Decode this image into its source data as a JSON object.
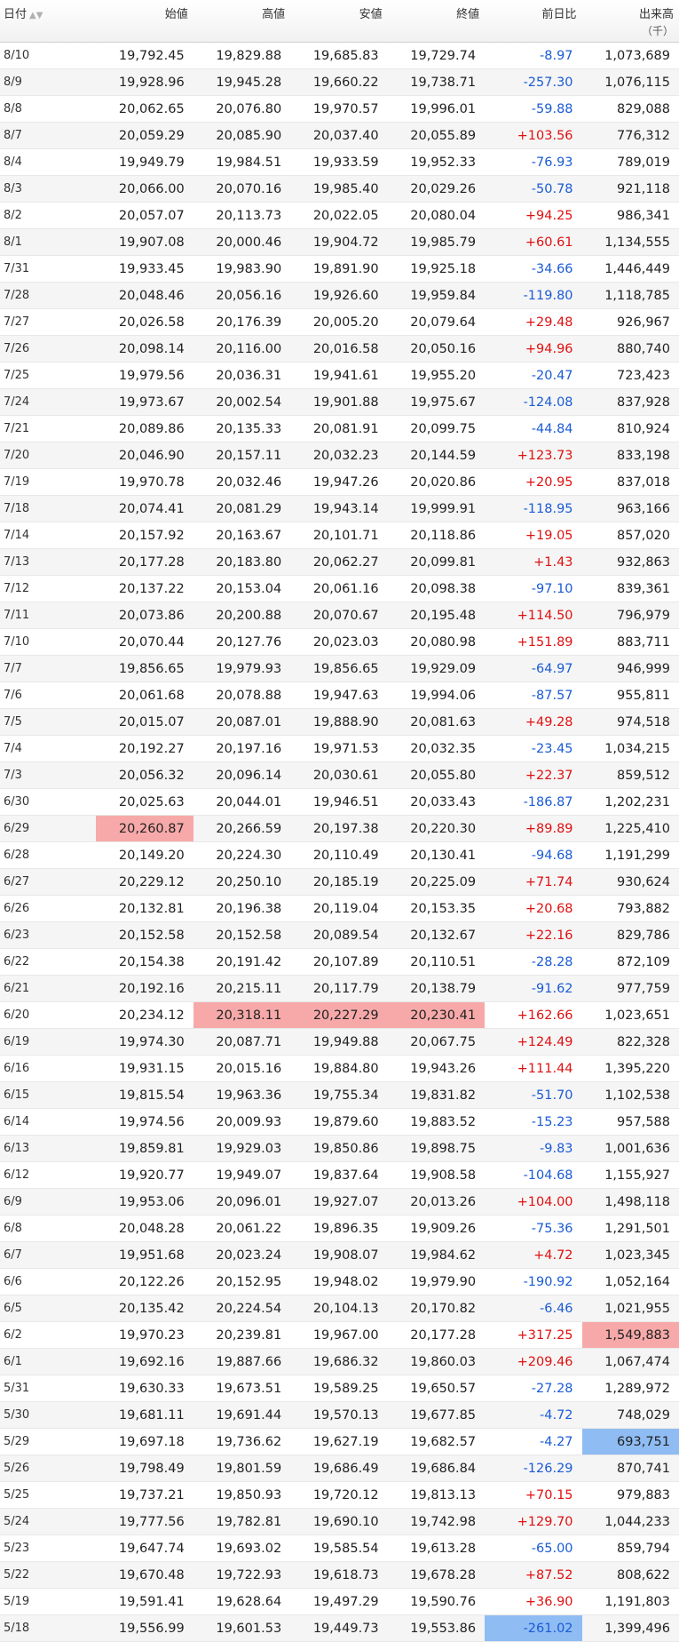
{
  "colors": {
    "positive": "#e01010",
    "negative": "#1a5bd6",
    "high_highlight": "#f7a9a9",
    "low_highlight": "#8fbcf3"
  },
  "header": {
    "date": "日付",
    "open": "始値",
    "high": "高値",
    "low": "安値",
    "close": "終値",
    "change": "前日比",
    "volume": "出来高",
    "volume_unit": "（千）",
    "sort_icons": "▲▼"
  },
  "rows": [
    {
      "date": "8/10",
      "open": "19,792.45",
      "high": "19,829.88",
      "low": "19,685.83",
      "close": "19,729.74",
      "change": "-8.97",
      "volume": "1,073,689"
    },
    {
      "date": "8/9",
      "open": "19,928.96",
      "high": "19,945.28",
      "low": "19,660.22",
      "close": "19,738.71",
      "change": "-257.30",
      "volume": "1,076,115"
    },
    {
      "date": "8/8",
      "open": "20,062.65",
      "high": "20,076.80",
      "low": "19,970.57",
      "close": "19,996.01",
      "change": "-59.88",
      "volume": "829,088"
    },
    {
      "date": "8/7",
      "open": "20,059.29",
      "high": "20,085.90",
      "low": "20,037.40",
      "close": "20,055.89",
      "change": "+103.56",
      "volume": "776,312"
    },
    {
      "date": "8/4",
      "open": "19,949.79",
      "high": "19,984.51",
      "low": "19,933.59",
      "close": "19,952.33",
      "change": "-76.93",
      "volume": "789,019"
    },
    {
      "date": "8/3",
      "open": "20,066.00",
      "high": "20,070.16",
      "low": "19,985.40",
      "close": "20,029.26",
      "change": "-50.78",
      "volume": "921,118"
    },
    {
      "date": "8/2",
      "open": "20,057.07",
      "high": "20,113.73",
      "low": "20,022.05",
      "close": "20,080.04",
      "change": "+94.25",
      "volume": "986,341"
    },
    {
      "date": "8/1",
      "open": "19,907.08",
      "high": "20,000.46",
      "low": "19,904.72",
      "close": "19,985.79",
      "change": "+60.61",
      "volume": "1,134,555"
    },
    {
      "date": "7/31",
      "open": "19,933.45",
      "high": "19,983.90",
      "low": "19,891.90",
      "close": "19,925.18",
      "change": "-34.66",
      "volume": "1,446,449"
    },
    {
      "date": "7/28",
      "open": "20,048.46",
      "high": "20,056.16",
      "low": "19,926.60",
      "close": "19,959.84",
      "change": "-119.80",
      "volume": "1,118,785"
    },
    {
      "date": "7/27",
      "open": "20,026.58",
      "high": "20,176.39",
      "low": "20,005.20",
      "close": "20,079.64",
      "change": "+29.48",
      "volume": "926,967"
    },
    {
      "date": "7/26",
      "open": "20,098.14",
      "high": "20,116.00",
      "low": "20,016.58",
      "close": "20,050.16",
      "change": "+94.96",
      "volume": "880,740"
    },
    {
      "date": "7/25",
      "open": "19,979.56",
      "high": "20,036.31",
      "low": "19,941.61",
      "close": "19,955.20",
      "change": "-20.47",
      "volume": "723,423"
    },
    {
      "date": "7/24",
      "open": "19,973.67",
      "high": "20,002.54",
      "low": "19,901.88",
      "close": "19,975.67",
      "change": "-124.08",
      "volume": "837,928"
    },
    {
      "date": "7/21",
      "open": "20,089.86",
      "high": "20,135.33",
      "low": "20,081.91",
      "close": "20,099.75",
      "change": "-44.84",
      "volume": "810,924"
    },
    {
      "date": "7/20",
      "open": "20,046.90",
      "high": "20,157.11",
      "low": "20,032.23",
      "close": "20,144.59",
      "change": "+123.73",
      "volume": "833,198"
    },
    {
      "date": "7/19",
      "open": "19,970.78",
      "high": "20,032.46",
      "low": "19,947.26",
      "close": "20,020.86",
      "change": "+20.95",
      "volume": "837,018"
    },
    {
      "date": "7/18",
      "open": "20,074.41",
      "high": "20,081.29",
      "low": "19,943.14",
      "close": "19,999.91",
      "change": "-118.95",
      "volume": "963,166"
    },
    {
      "date": "7/14",
      "open": "20,157.92",
      "high": "20,163.67",
      "low": "20,101.71",
      "close": "20,118.86",
      "change": "+19.05",
      "volume": "857,020"
    },
    {
      "date": "7/13",
      "open": "20,177.28",
      "high": "20,183.80",
      "low": "20,062.27",
      "close": "20,099.81",
      "change": "+1.43",
      "volume": "932,863"
    },
    {
      "date": "7/12",
      "open": "20,137.22",
      "high": "20,153.04",
      "low": "20,061.16",
      "close": "20,098.38",
      "change": "-97.10",
      "volume": "839,361"
    },
    {
      "date": "7/11",
      "open": "20,073.86",
      "high": "20,200.88",
      "low": "20,070.67",
      "close": "20,195.48",
      "change": "+114.50",
      "volume": "796,979"
    },
    {
      "date": "7/10",
      "open": "20,070.44",
      "high": "20,127.76",
      "low": "20,023.03",
      "close": "20,080.98",
      "change": "+151.89",
      "volume": "883,711"
    },
    {
      "date": "7/7",
      "open": "19,856.65",
      "high": "19,979.93",
      "low": "19,856.65",
      "close": "19,929.09",
      "change": "-64.97",
      "volume": "946,999"
    },
    {
      "date": "7/6",
      "open": "20,061.68",
      "high": "20,078.88",
      "low": "19,947.63",
      "close": "19,994.06",
      "change": "-87.57",
      "volume": "955,811"
    },
    {
      "date": "7/5",
      "open": "20,015.07",
      "high": "20,087.01",
      "low": "19,888.90",
      "close": "20,081.63",
      "change": "+49.28",
      "volume": "974,518"
    },
    {
      "date": "7/4",
      "open": "20,192.27",
      "high": "20,197.16",
      "low": "19,971.53",
      "close": "20,032.35",
      "change": "-23.45",
      "volume": "1,034,215"
    },
    {
      "date": "7/3",
      "open": "20,056.32",
      "high": "20,096.14",
      "low": "20,030.61",
      "close": "20,055.80",
      "change": "+22.37",
      "volume": "859,512"
    },
    {
      "date": "6/30",
      "open": "20,025.63",
      "high": "20,044.01",
      "low": "19,946.51",
      "close": "20,033.43",
      "change": "-186.87",
      "volume": "1,202,231"
    },
    {
      "date": "6/29",
      "open": "20,260.87",
      "high": "20,266.59",
      "low": "20,197.38",
      "close": "20,220.30",
      "change": "+89.89",
      "volume": "1,225,410",
      "hi": [
        "open"
      ]
    },
    {
      "date": "6/28",
      "open": "20,149.20",
      "high": "20,224.30",
      "low": "20,110.49",
      "close": "20,130.41",
      "change": "-94.68",
      "volume": "1,191,299"
    },
    {
      "date": "6/27",
      "open": "20,229.12",
      "high": "20,250.10",
      "low": "20,185.19",
      "close": "20,225.09",
      "change": "+71.74",
      "volume": "930,624"
    },
    {
      "date": "6/26",
      "open": "20,132.81",
      "high": "20,196.38",
      "low": "20,119.04",
      "close": "20,153.35",
      "change": "+20.68",
      "volume": "793,882"
    },
    {
      "date": "6/23",
      "open": "20,152.58",
      "high": "20,152.58",
      "low": "20,089.54",
      "close": "20,132.67",
      "change": "+22.16",
      "volume": "829,786"
    },
    {
      "date": "6/22",
      "open": "20,154.38",
      "high": "20,191.42",
      "low": "20,107.89",
      "close": "20,110.51",
      "change": "-28.28",
      "volume": "872,109"
    },
    {
      "date": "6/21",
      "open": "20,192.16",
      "high": "20,215.11",
      "low": "20,117.79",
      "close": "20,138.79",
      "change": "-91.62",
      "volume": "977,759"
    },
    {
      "date": "6/20",
      "open": "20,234.12",
      "high": "20,318.11",
      "low": "20,227.29",
      "close": "20,230.41",
      "change": "+162.66",
      "volume": "1,023,651",
      "hi": [
        "high",
        "low",
        "close"
      ]
    },
    {
      "date": "6/19",
      "open": "19,974.30",
      "high": "20,087.71",
      "low": "19,949.88",
      "close": "20,067.75",
      "change": "+124.49",
      "volume": "822,328"
    },
    {
      "date": "6/16",
      "open": "19,931.15",
      "high": "20,015.16",
      "low": "19,884.80",
      "close": "19,943.26",
      "change": "+111.44",
      "volume": "1,395,220"
    },
    {
      "date": "6/15",
      "open": "19,815.54",
      "high": "19,963.36",
      "low": "19,755.34",
      "close": "19,831.82",
      "change": "-51.70",
      "volume": "1,102,538"
    },
    {
      "date": "6/14",
      "open": "19,974.56",
      "high": "20,009.93",
      "low": "19,879.60",
      "close": "19,883.52",
      "change": "-15.23",
      "volume": "957,588"
    },
    {
      "date": "6/13",
      "open": "19,859.81",
      "high": "19,929.03",
      "low": "19,850.86",
      "close": "19,898.75",
      "change": "-9.83",
      "volume": "1,001,636"
    },
    {
      "date": "6/12",
      "open": "19,920.77",
      "high": "19,949.07",
      "low": "19,837.64",
      "close": "19,908.58",
      "change": "-104.68",
      "volume": "1,155,927"
    },
    {
      "date": "6/9",
      "open": "19,953.06",
      "high": "20,096.01",
      "low": "19,927.07",
      "close": "20,013.26",
      "change": "+104.00",
      "volume": "1,498,118"
    },
    {
      "date": "6/8",
      "open": "20,048.28",
      "high": "20,061.22",
      "low": "19,896.35",
      "close": "19,909.26",
      "change": "-75.36",
      "volume": "1,291,501"
    },
    {
      "date": "6/7",
      "open": "19,951.68",
      "high": "20,023.24",
      "low": "19,908.07",
      "close": "19,984.62",
      "change": "+4.72",
      "volume": "1,023,345"
    },
    {
      "date": "6/6",
      "open": "20,122.26",
      "high": "20,152.95",
      "low": "19,948.02",
      "close": "19,979.90",
      "change": "-190.92",
      "volume": "1,052,164"
    },
    {
      "date": "6/5",
      "open": "20,135.42",
      "high": "20,224.54",
      "low": "20,104.13",
      "close": "20,170.82",
      "change": "-6.46",
      "volume": "1,021,955"
    },
    {
      "date": "6/2",
      "open": "19,970.23",
      "high": "20,239.81",
      "low": "19,967.00",
      "close": "20,177.28",
      "change": "+317.25",
      "volume": "1,549,883",
      "hi": [
        "volume"
      ]
    },
    {
      "date": "6/1",
      "open": "19,692.16",
      "high": "19,887.66",
      "low": "19,686.32",
      "close": "19,860.03",
      "change": "+209.46",
      "volume": "1,067,474"
    },
    {
      "date": "5/31",
      "open": "19,630.33",
      "high": "19,673.51",
      "low": "19,589.25",
      "close": "19,650.57",
      "change": "-27.28",
      "volume": "1,289,972"
    },
    {
      "date": "5/30",
      "open": "19,681.11",
      "high": "19,691.44",
      "low": "19,570.13",
      "close": "19,677.85",
      "change": "-4.72",
      "volume": "748,029"
    },
    {
      "date": "5/29",
      "open": "19,697.18",
      "high": "19,736.62",
      "low": "19,627.19",
      "close": "19,682.57",
      "change": "-4.27",
      "volume": "693,751",
      "lo": [
        "volume"
      ]
    },
    {
      "date": "5/26",
      "open": "19,798.49",
      "high": "19,801.59",
      "low": "19,686.49",
      "close": "19,686.84",
      "change": "-126.29",
      "volume": "870,741"
    },
    {
      "date": "5/25",
      "open": "19,737.21",
      "high": "19,850.93",
      "low": "19,720.12",
      "close": "19,813.13",
      "change": "+70.15",
      "volume": "979,883"
    },
    {
      "date": "5/24",
      "open": "19,777.56",
      "high": "19,782.81",
      "low": "19,690.10",
      "close": "19,742.98",
      "change": "+129.70",
      "volume": "1,044,233"
    },
    {
      "date": "5/23",
      "open": "19,647.74",
      "high": "19,693.02",
      "low": "19,585.54",
      "close": "19,613.28",
      "change": "-65.00",
      "volume": "859,794"
    },
    {
      "date": "5/22",
      "open": "19,670.48",
      "high": "19,722.93",
      "low": "19,618.73",
      "close": "19,678.28",
      "change": "+87.52",
      "volume": "808,622"
    },
    {
      "date": "5/19",
      "open": "19,591.41",
      "high": "19,628.64",
      "low": "19,497.29",
      "close": "19,590.76",
      "change": "+36.90",
      "volume": "1,191,803"
    },
    {
      "date": "5/18",
      "open": "19,556.99",
      "high": "19,601.53",
      "low": "19,449.73",
      "close": "19,553.86",
      "change": "-261.02",
      "volume": "1,399,496",
      "lo": [
        "change"
      ]
    }
  ]
}
